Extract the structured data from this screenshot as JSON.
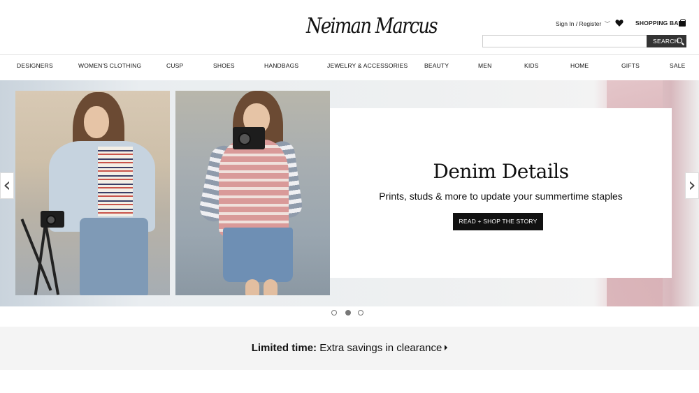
{
  "header": {
    "logo": "Neiman Marcus",
    "sign_in": "Sign In / Register",
    "shopping_bag": "SHOPPING BAG",
    "search_placeholder": "",
    "search_button": "SEARCH"
  },
  "nav": {
    "items": [
      "DESIGNERS",
      "WOMEN'S CLOTHING",
      "CUSP",
      "SHOES",
      "HANDBAGS",
      "JEWELRY & ACCESSORIES",
      "BEAUTY",
      "MEN",
      "KIDS",
      "HOME",
      "GIFTS",
      "SALE"
    ]
  },
  "hero": {
    "headline": "Denim Details",
    "subhead": "Prints, studs & more to update your summertime staples",
    "cta": "READ + SHOP THE STORY",
    "prev_arrow": "‹",
    "next_arrow": "›",
    "slide_count": 3,
    "active_slide": 2
  },
  "promo": {
    "bold": "Limited time:",
    "text": " Extra savings in clearance"
  },
  "colors": {
    "accent_dark": "#111111",
    "search_button_bg": "#333333",
    "promo_bg": "#f4f4f4"
  },
  "icons": [
    "chevron-down-icon",
    "heart-icon",
    "shopping-bag-icon",
    "search-icon",
    "arrow-left-icon",
    "arrow-right-icon",
    "caret-right-icon"
  ]
}
